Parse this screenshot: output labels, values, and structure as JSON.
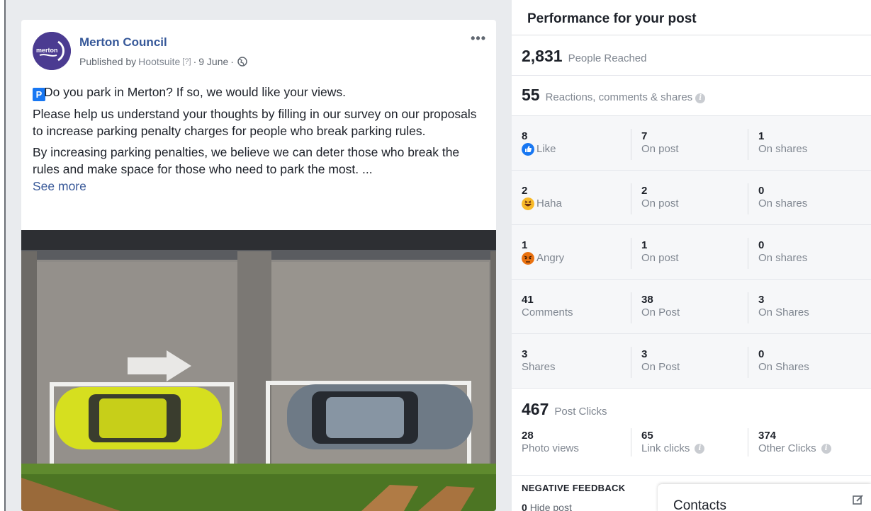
{
  "post": {
    "page_name": "Merton Council",
    "avatar_text": "merton",
    "published_by_prefix": "Published by",
    "publisher": "Hootsuite",
    "help_marker": "[?]",
    "separator": "·",
    "date": "9 June",
    "paragraph1": "Do you park in Merton? If so, we would like your views.",
    "p_badge": "P",
    "paragraph2": "Please help us understand your thoughts by filling in our survey on our proposals to increase parking penalty charges for people who break parking rules.",
    "paragraph3": "By increasing parking penalties, we believe we can deter those who break the rules and make space for those who need to park the most. ...",
    "see_more": "See more",
    "more_icon": "•••"
  },
  "insights": {
    "title": "Performance for your post",
    "people_reached": {
      "value": "2,831",
      "label": "People Reached"
    },
    "engagement": {
      "value": "55",
      "label": "Reactions, comments & shares"
    },
    "rows": [
      {
        "total": "8",
        "label": "Like",
        "icon": "like-icon",
        "col2_value": "7",
        "col2_label": "On post",
        "col3_value": "1",
        "col3_label": "On shares"
      },
      {
        "total": "2",
        "label": "Haha",
        "icon": "haha-icon",
        "col2_value": "2",
        "col2_label": "On post",
        "col3_value": "0",
        "col3_label": "On shares"
      },
      {
        "total": "1",
        "label": "Angry",
        "icon": "angry-icon",
        "col2_value": "1",
        "col2_label": "On post",
        "col3_value": "0",
        "col3_label": "On shares"
      },
      {
        "total": "41",
        "label": "Comments",
        "col2_value": "38",
        "col2_label": "On Post",
        "col3_value": "3",
        "col3_label": "On Shares"
      },
      {
        "total": "3",
        "label": "Shares",
        "col2_value": "3",
        "col2_label": "On Post",
        "col3_value": "0",
        "col3_label": "On Shares"
      }
    ],
    "post_clicks": {
      "value": "467",
      "label": "Post Clicks"
    },
    "clicks": [
      {
        "value": "28",
        "label": "Photo views"
      },
      {
        "value": "65",
        "label": "Link clicks"
      },
      {
        "value": "374",
        "label": "Other Clicks"
      }
    ],
    "negative_feedback": {
      "title": "NEGATIVE FEEDBACK",
      "hide_post_value": "0",
      "hide_post_label": "Hide post"
    }
  },
  "contacts": {
    "title": "Contacts"
  },
  "colors": {
    "link_blue": "#365899",
    "like_blue": "#1877f2",
    "car_yellow": "#d6df1f",
    "car_grey": "#6e7a86"
  }
}
